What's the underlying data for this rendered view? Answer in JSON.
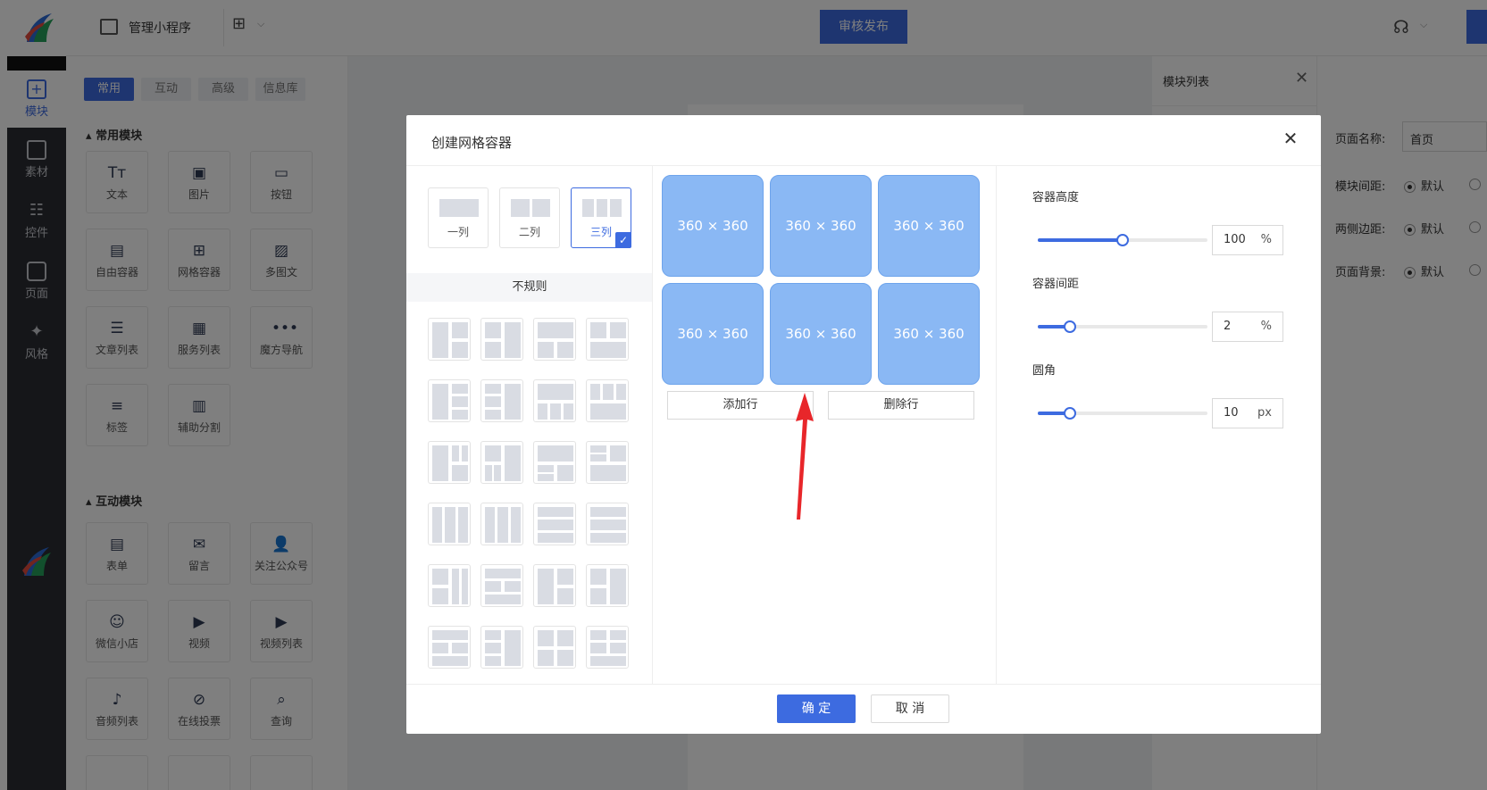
{
  "topbar": {
    "manage_label": "管理小程序",
    "publish_label": "审核发布"
  },
  "nav": {
    "items": [
      {
        "label": "模块",
        "icon": "plus-square-icon"
      },
      {
        "label": "素材",
        "icon": "material-icon"
      },
      {
        "label": "控件",
        "icon": "controls-icon"
      },
      {
        "label": "页面",
        "icon": "pages-icon"
      },
      {
        "label": "风格",
        "icon": "magic-wand-icon"
      }
    ]
  },
  "module_panel": {
    "tabs": [
      "常用",
      "互动",
      "高级",
      "信息库"
    ],
    "common_title": "常用模块",
    "common_items": [
      "文本",
      "图片",
      "按钮",
      "自由容器",
      "网格容器",
      "多图文",
      "文章列表",
      "服务列表",
      "魔方导航",
      "标签",
      "辅助分割"
    ],
    "interactive_title": "互动模块",
    "interactive_items": [
      "表单",
      "留言",
      "关注公众号",
      "微信小店",
      "视频",
      "视频列表",
      "音频列表",
      "在线投票",
      "查询"
    ]
  },
  "right_panel": {
    "title": "模块列表",
    "page_name_label": "页面名称:",
    "page_name_value": "首页",
    "module_gap_label": "模块间距:",
    "side_margin_label": "两侧边距:",
    "page_bg_label": "页面背景:",
    "default_label": "默认"
  },
  "dialog": {
    "title": "创建网格容器",
    "layouts": [
      {
        "label": "一列",
        "cols": 1,
        "selected": false
      },
      {
        "label": "二列",
        "cols": 2,
        "selected": false
      },
      {
        "label": "三列",
        "cols": 3,
        "selected": true
      }
    ],
    "irregular_label": "不规则",
    "cells": [
      "360 × 360",
      "360 × 360",
      "360 × 360",
      "360 × 360",
      "360 × 360",
      "360 × 360"
    ],
    "add_row_label": "添加行",
    "delete_row_label": "删除行",
    "props": [
      {
        "label": "容器高度",
        "value": "100",
        "unit": "%",
        "slider_fraction": 0.5
      },
      {
        "label": "容器间距",
        "value": "2",
        "unit": "%",
        "slider_fraction": 0.19
      },
      {
        "label": "圆角",
        "value": "10",
        "unit": "px",
        "slider_fraction": 0.19
      }
    ],
    "ok_label": "确 定",
    "cancel_label": "取 消"
  },
  "colors": {
    "accent": "#3d6be0",
    "cell": "#8ab8f4",
    "nav_bg": "#2b2d33",
    "arrow": "#e8262a"
  }
}
